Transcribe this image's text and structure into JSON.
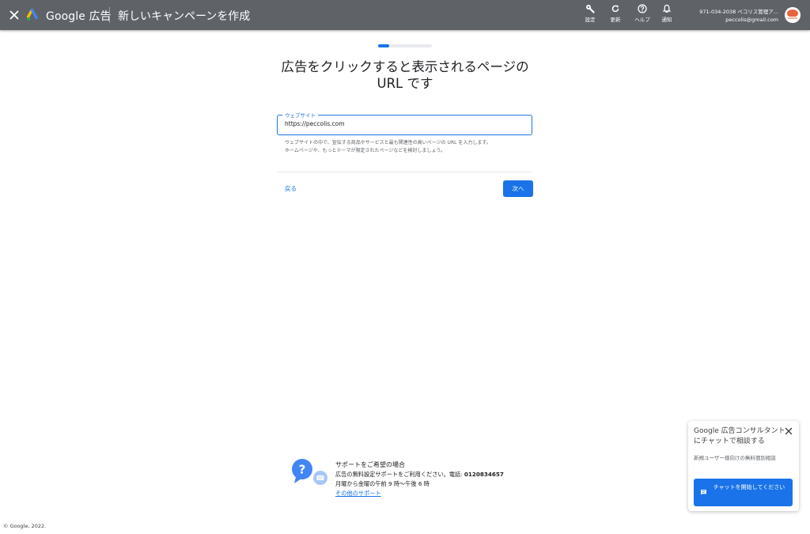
{
  "header": {
    "brand": "Google 広告",
    "page_title": "新しいキャンペーンを作成",
    "tools": [
      {
        "label": "設定",
        "icon": "wrench-icon"
      },
      {
        "label": "更新",
        "icon": "refresh-icon"
      },
      {
        "label": "ヘルプ",
        "icon": "help-icon"
      },
      {
        "label": "通知",
        "icon": "bell-icon"
      }
    ],
    "account_id": "971-034-2038 ペコリス管理ア...",
    "account_email": "peccolis@gmail.com"
  },
  "progress": {
    "fraction": 0.2
  },
  "main": {
    "heading_line1": "広告をクリックすると表示されるページの",
    "heading_line2": "URL です",
    "website_label": "ウェブサイト",
    "website_value": "https://peccolis.com",
    "hint_line1": "ウェブサイトの中で、宣伝する商品やサービスと最も関連性の高いページの URL を入力します。",
    "hint_line2": "ホームページや、もっとテーマが限定されたページなどを検討しましょう。",
    "back_label": "戻る",
    "next_label": "次へ"
  },
  "support": {
    "title": "サポートをご希望の場合",
    "line1_prefix": "広告の無料設定サポートをご利用ください。電話: ",
    "phone": "0120834657",
    "hours": "月曜から金曜の午前 9 時〜午後 6 時",
    "other_link": "その他のサポート"
  },
  "footer": {
    "copyright": "© Google, 2022."
  },
  "chat": {
    "title": "Google 広告コンサルタントにチャットで相談する",
    "description": "新規ユーザー様向けの無料個別相談",
    "button_label": "チャットを開始してください"
  },
  "colors": {
    "accent": "#1a73e8",
    "header": "#5f6368"
  }
}
